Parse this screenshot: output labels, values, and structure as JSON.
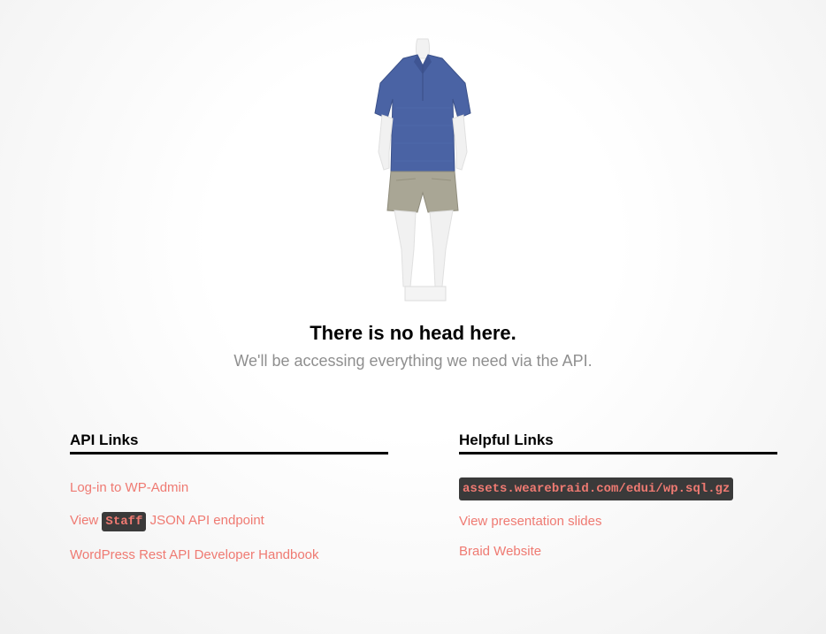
{
  "hero": {
    "title": "There is no head here.",
    "subtitle": "We'll be accessing everything we need via the API."
  },
  "api_links": {
    "heading": "API Links",
    "items": [
      {
        "label": "Log-in to WP-Admin"
      },
      {
        "prefix": "View",
        "code": "Staff",
        "suffix": "JSON API endpoint"
      },
      {
        "label": "WordPress Rest API Developer Handbook"
      }
    ]
  },
  "helpful_links": {
    "heading": "Helpful Links",
    "items": [
      {
        "code": "assets.wearebraid.com/edui/wp.sql.gz"
      },
      {
        "label": "View presentation slides"
      },
      {
        "label": "Braid Website"
      }
    ]
  },
  "colors": {
    "link": "#ef7a72",
    "code_bg": "#3a3a3a",
    "subtitle": "#8f8f8f"
  },
  "images": {
    "mannequin": "mannequin-photo"
  }
}
